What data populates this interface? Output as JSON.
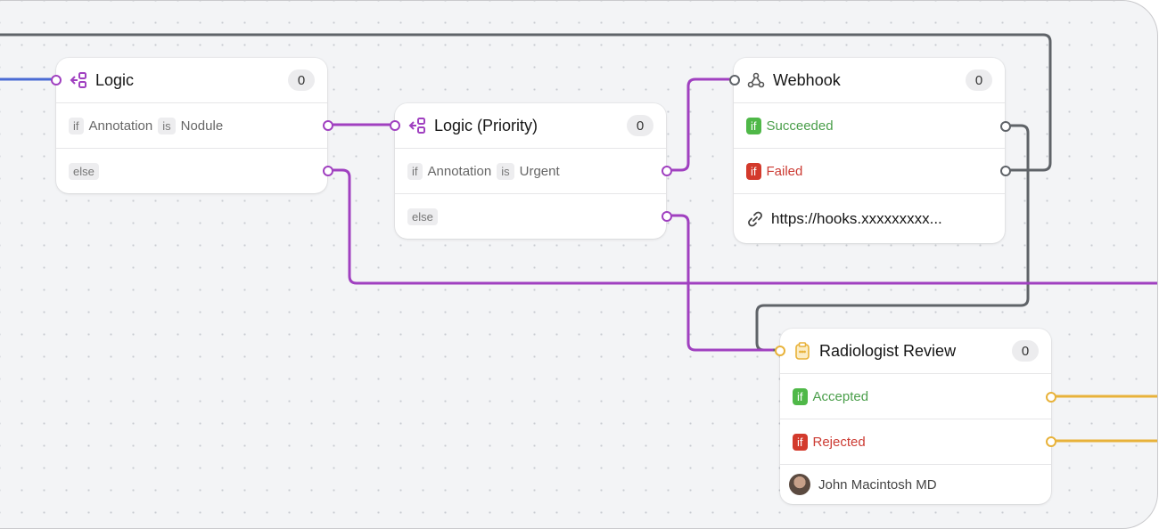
{
  "colors": {
    "logic": "#a040c0",
    "webhook_wire": "#5f6368",
    "review": "#e8b23a",
    "input_wire": "#4a6bd4",
    "success": "#4fb848",
    "failure": "#d33a2c"
  },
  "nodes": {
    "logic": {
      "title": "Logic",
      "icon": "branch-icon",
      "count": "0",
      "rows": [
        {
          "if": "if",
          "field": "Annotation",
          "op": "is",
          "value": "Nodule"
        },
        {
          "else": "else"
        }
      ]
    },
    "logic_priority": {
      "title": "Logic (Priority)",
      "icon": "branch-icon",
      "count": "0",
      "rows": [
        {
          "if": "if",
          "field": "Annotation",
          "op": "is",
          "value": "Urgent"
        },
        {
          "else": "else"
        }
      ]
    },
    "webhook": {
      "title": "Webhook",
      "icon": "webhook-icon",
      "count": "0",
      "rows": [
        {
          "if": "if",
          "label": "Succeeded"
        },
        {
          "if": "if",
          "label": "Failed"
        }
      ],
      "url": "https://hooks.xxxxxxxxx..."
    },
    "review": {
      "title": "Radiologist Review",
      "icon": "clipboard-icon",
      "count": "0",
      "rows": [
        {
          "if": "if",
          "label": "Accepted"
        },
        {
          "if": "if",
          "label": "Rejected"
        }
      ],
      "assignee": "John Macintosh MD"
    }
  }
}
